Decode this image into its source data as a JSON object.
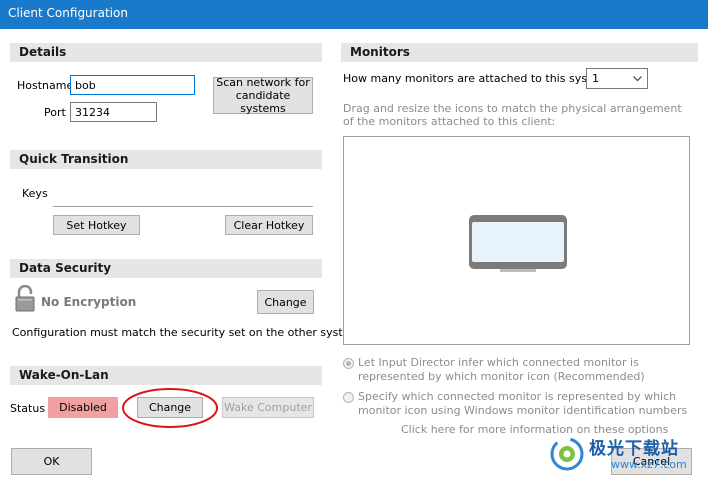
{
  "window": {
    "title": "Client Configuration"
  },
  "details": {
    "header": "Details",
    "hostname_label": "Hostname",
    "hostname_value": "bob",
    "port_label": "Port",
    "port_value": "31234",
    "scan_button": "Scan network for candidate systems"
  },
  "quick_transition": {
    "header": "Quick Transition",
    "keys_label": "Keys",
    "set_hotkey": "Set Hotkey",
    "clear_hotkey": "Clear Hotkey"
  },
  "data_security": {
    "header": "Data Security",
    "encryption_label": "No Encryption",
    "change_button": "Change",
    "note": "Configuration must match the security set on the other system"
  },
  "wake_on_lan": {
    "header": "Wake-On-Lan",
    "status_label": "Status",
    "status_value": "Disabled",
    "change_button": "Change",
    "wake_button": "Wake Computer"
  },
  "monitors": {
    "header": "Monitors",
    "count_label": "How many monitors are attached to this system",
    "count_value": "1",
    "instructions": "Drag and resize the icons to match the physical arrangement of the monitors attached to this client:",
    "radio1": "Let Input Director infer which connected monitor is represented by which monitor icon (Recommended)",
    "radio2": "Specify which connected monitor is represented by which monitor icon using Windows monitor identification numbers",
    "info_link": "Click here for more information on these options"
  },
  "footer": {
    "ok": "OK",
    "cancel": "Cancel"
  },
  "watermark": {
    "text": "极光下载站",
    "url": "www.xz7.com"
  },
  "colors": {
    "titlebar": "#1979ca",
    "disabled_badge": "#f0a0a0",
    "highlight_circle": "#d9141b"
  }
}
